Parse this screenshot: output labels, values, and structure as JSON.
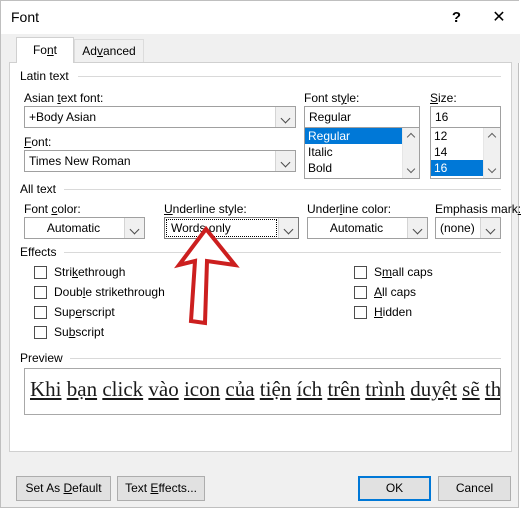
{
  "window": {
    "title": "Font",
    "help_icon": "?",
    "close_icon": "✕"
  },
  "tabs": [
    {
      "label": "Font",
      "accel": "n",
      "active": true
    },
    {
      "label": "Advanced",
      "accel": "v",
      "active": false
    }
  ],
  "groups": {
    "latin_text": {
      "label": "Latin text",
      "asian_font": {
        "label_pre": "Asian ",
        "label_accel": "t",
        "label_post": "ext font:",
        "value": "+Body Asian"
      },
      "font": {
        "label_pre": "",
        "label_accel": "F",
        "label_post": "ont:",
        "value": "Times New Roman"
      },
      "font_style": {
        "label_pre": "Font st",
        "label_accel": "y",
        "label_post": "le:",
        "value": "Regular",
        "options": [
          "Regular",
          "Italic",
          "Bold"
        ],
        "selected": "Regular"
      },
      "size": {
        "label_pre": "",
        "label_accel": "S",
        "label_post": "ize:",
        "value": "16",
        "options": [
          "12",
          "14",
          "16"
        ],
        "selected": "16"
      }
    },
    "all_text": {
      "label": "All text",
      "font_color": {
        "label_pre": "Font ",
        "label_accel": "c",
        "label_post": "olor:",
        "value": "Automatic"
      },
      "underline_style": {
        "label_pre": "",
        "label_accel": "U",
        "label_post": "nderline style:",
        "value": "Words only",
        "focused": true
      },
      "underline_color": {
        "label_pre": "Under",
        "label_accel": "l",
        "label_post": "ine color:",
        "value": "Automatic"
      },
      "emphasis_mark": {
        "label_pre": "Emphasis mark",
        "label_accel": ":",
        "label_post": "",
        "value": "(none)"
      }
    },
    "effects": {
      "label": "Effects",
      "left_column": [
        {
          "pre": "Stri",
          "accel": "k",
          "post": "ethrough",
          "checked": false
        },
        {
          "pre": "Doub",
          "accel": "l",
          "post": "e strikethrough",
          "checked": false
        },
        {
          "pre": "Sup",
          "accel": "e",
          "post": "rscript",
          "checked": false
        },
        {
          "pre": "Su",
          "accel": "b",
          "post": "script",
          "checked": false
        }
      ],
      "right_column": [
        {
          "pre": "S",
          "accel": "m",
          "post": "all caps",
          "checked": false
        },
        {
          "pre": "",
          "accel": "A",
          "post": "ll caps",
          "checked": false
        },
        {
          "pre": "",
          "accel": "H",
          "post": "idden",
          "checked": false
        }
      ]
    },
    "preview": {
      "label": "Preview",
      "words": [
        "Khi",
        "bạn",
        "click",
        "vào",
        "icon",
        "của",
        "tiện",
        "ích",
        "trên",
        "trình",
        "duyệt",
        "sẽ",
        "thấy"
      ]
    }
  },
  "footer": {
    "set_as_default": {
      "pre": "Set As ",
      "accel": "D",
      "post": "efault"
    },
    "text_effects": {
      "pre": "Text ",
      "accel": "E",
      "post": "ffects..."
    },
    "ok": "OK",
    "cancel": "Cancel"
  },
  "annotation": {
    "arrow_color": "#cc1f1f",
    "points_to": "underline-style-combo"
  }
}
